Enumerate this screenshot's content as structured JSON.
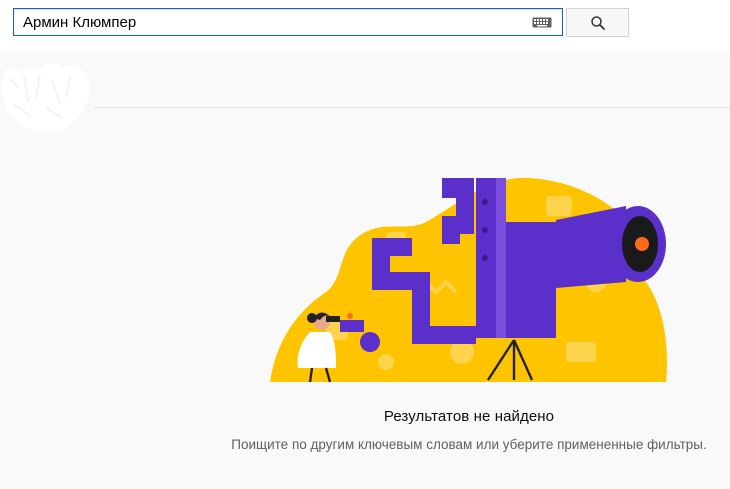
{
  "search": {
    "query": "Армин Клюмпер",
    "keyboard_icon": "keyboard-icon",
    "search_icon": "magnifier-icon"
  },
  "empty_state": {
    "title": "Результатов не найдено",
    "hint": "Поищите по другим ключевым словам или уберите примененные фильтры."
  },
  "colors": {
    "accent_blue": "#1c62b9",
    "illustration_yellow": "#ffc400",
    "illustration_purple": "#5b2fc9"
  }
}
